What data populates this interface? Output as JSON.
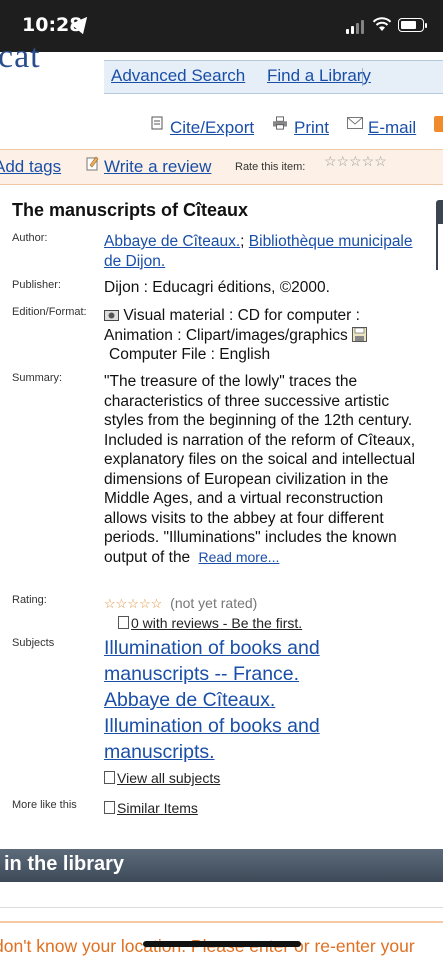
{
  "status": {
    "time": "10:28"
  },
  "header": {
    "logo_fragment": "cat",
    "advanced_search": "Advanced Search",
    "find_library": "Find a Library"
  },
  "toolbar": {
    "cite": "Cite/Export",
    "print": "Print",
    "email": "E-mail"
  },
  "tagbar": {
    "add_tags": "Add tags",
    "write_review": "Write a review",
    "rate_label": "Rate this item:",
    "stars": "☆☆☆☆☆"
  },
  "record": {
    "title": "The manuscripts of Cîteaux",
    "author_label": "Author:",
    "author_1": "Abbaye de Cîteaux.",
    "author_sep": ";",
    "author_2": "Bibliothèque municipale de Dijon.",
    "publisher_label": "Publisher:",
    "publisher": "Dijon : Educagri éditions, ©2000.",
    "edition_label": "Edition/Format:",
    "edition_1": "Visual material : CD for computer : Animation : Clipart/images/graphics",
    "edition_2": "Computer File : English",
    "summary_label": "Summary:",
    "summary": "\"The treasure of the lowly\" traces the characteristics of three successive artistic styles from the beginning of the 12th century. Included is narration of the reform of Cîteaux, explanatory files on the soical and intellectual dimensions of European civilization in the Middle Ages, and a virtual reconstruction allows visits to the abbey at four different periods. \"Illuminations\" includes the known output of the",
    "read_more": "Read more...",
    "rating_label": "Rating:",
    "rating_stars": "☆☆☆☆☆",
    "rating_text": "(not yet rated)",
    "reviews_link": "0 with reviews - Be the first.",
    "subjects_label": "Subjects",
    "subjects": [
      "Illumination of books and manuscripts -- France.",
      "Abbaye de Cîteaux.",
      "Illumination of books and manuscripts."
    ],
    "view_all": "View all subjects",
    "more_label": "More like this",
    "similar": "Similar Items"
  },
  "library": {
    "heading": "in the library",
    "location_warning": "don't know your location. Please enter or re-enter your"
  }
}
